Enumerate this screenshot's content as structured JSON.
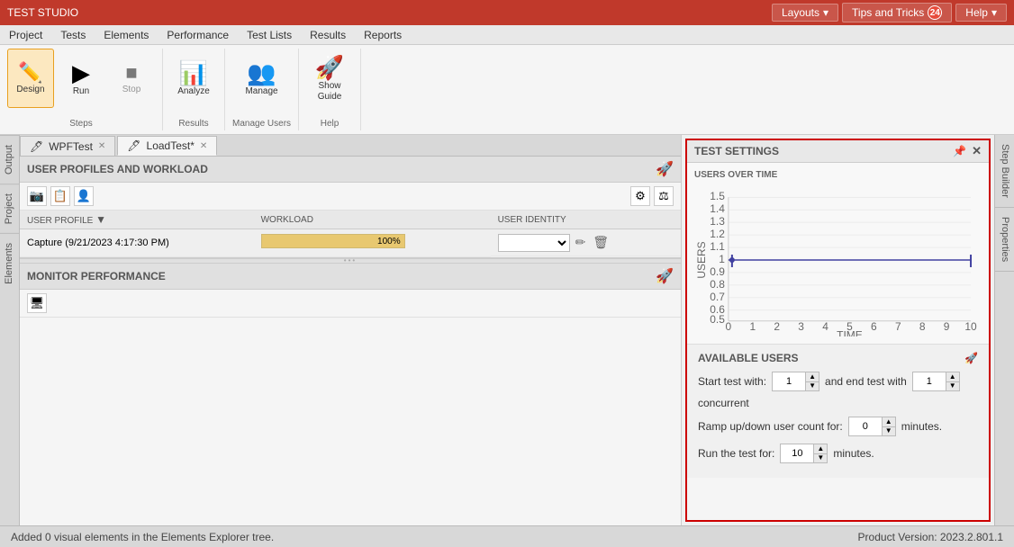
{
  "titleBar": {
    "title": "TEST STUDIO",
    "layouts_label": "Layouts",
    "tips_label": "Tips and Tricks",
    "tips_count": "24",
    "help_label": "Help"
  },
  "menuBar": {
    "items": [
      "Project",
      "Tests",
      "Elements",
      "Performance",
      "Test Lists",
      "Results",
      "Reports"
    ]
  },
  "ribbon": {
    "groups": [
      {
        "label": "Steps",
        "items": [
          {
            "id": "design",
            "label": "Design",
            "icon": "✏",
            "active": true
          },
          {
            "id": "run",
            "label": "Run",
            "icon": "▶",
            "active": false
          },
          {
            "id": "stop",
            "label": "Stop",
            "icon": "⬛",
            "active": false,
            "disabled": true
          }
        ]
      },
      {
        "label": "Results",
        "items": [
          {
            "id": "analyze",
            "label": "Analyze",
            "icon": "📊",
            "active": false
          }
        ]
      },
      {
        "label": "Manage Users",
        "items": [
          {
            "id": "manage",
            "label": "Manage",
            "icon": "👥",
            "active": false
          }
        ]
      },
      {
        "label": "Help",
        "items": [
          {
            "id": "show-guide",
            "label": "Show\nGuide",
            "icon": "🚀",
            "active": false
          }
        ]
      }
    ]
  },
  "tabs": [
    {
      "id": "wpftest",
      "label": "WPFTest",
      "closable": true,
      "active": false,
      "icon": "🖊"
    },
    {
      "id": "loadtest",
      "label": "LoadTest*",
      "closable": true,
      "active": true,
      "icon": "🖊"
    }
  ],
  "userProfiles": {
    "sectionLabel": "USER PROFILES AND WORKLOAD",
    "columns": [
      "USER PROFILE",
      "WORKLOAD",
      "USER IDENTITY"
    ],
    "rows": [
      {
        "profile": "Capture (9/21/2023 4:17:30 PM)",
        "workload": "100%",
        "identity": ""
      }
    ]
  },
  "monitorPerformance": {
    "sectionLabel": "MONITOR PERFORMANCE"
  },
  "testSettings": {
    "title": "TEST SETTINGS",
    "chartSection": {
      "label": "USERS OVER TIME",
      "yAxisLabel": "USERS",
      "xAxisLabel": "TIME",
      "yValues": [
        1.5,
        1.4,
        1.3,
        1.2,
        1.1,
        1.0,
        0.9,
        0.8,
        0.7,
        0.6,
        0.5
      ],
      "xValues": [
        0,
        1,
        2,
        3,
        4,
        5,
        6,
        7,
        8,
        9,
        10
      ]
    },
    "availableUsers": {
      "label": "AVAILABLE USERS",
      "startTestWith": "1",
      "endTestWith": "1",
      "rampUpDown": "0",
      "runFor": "10",
      "row1_prefix": "Start test with:",
      "row1_mid": "and end test with",
      "row1_suffix": "concurrent",
      "row2_prefix": "Ramp up/down user count for:",
      "row2_suffix": "minutes.",
      "row3_prefix": "Run the test for:",
      "row3_suffix": "minutes."
    }
  },
  "statusBar": {
    "message": "Added 0 visual elements in the Elements Explorer tree.",
    "version": "Product Version: 2023.2.801.1"
  },
  "sideTabs": {
    "left": [
      "Output",
      "Project",
      "Elements"
    ],
    "right": [
      "Step Builder",
      "Properties"
    ]
  }
}
